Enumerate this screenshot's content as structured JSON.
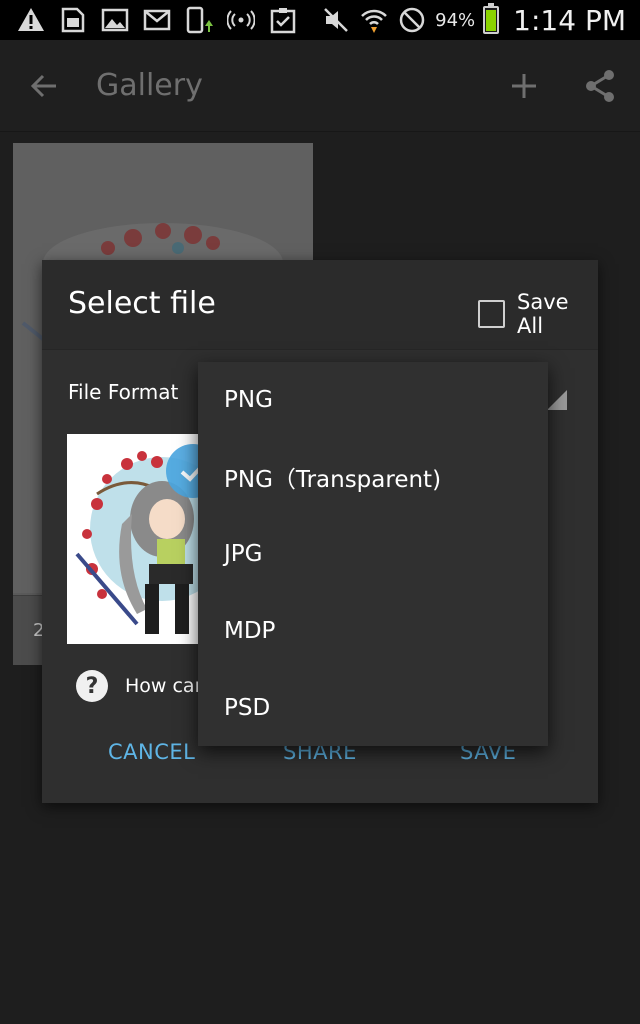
{
  "status_bar": {
    "battery_percent": "94%",
    "battery_level": 0.94,
    "time": "1:14 PM",
    "left_icons": [
      "warning-icon",
      "sim-card-icon",
      "image-icon",
      "gmail-icon",
      "phone-sync-icon",
      "radio-waves-icon",
      "clipboard-check-icon"
    ],
    "right_icons": [
      "mute-icon",
      "wifi-icon",
      "do-not-disturb-icon"
    ]
  },
  "action_bar": {
    "title": "Gallery"
  },
  "gallery": {
    "caption": "2"
  },
  "dialog": {
    "title": "Select file",
    "save_all_label": "Save All",
    "file_format_label": "File Format",
    "help_text": "How car",
    "buttons": {
      "cancel": "CANCEL",
      "share": "SHARE",
      "save": "SAVE"
    }
  },
  "dropdown": {
    "options": [
      "PNG",
      "PNG（Transparent)",
      "JPG",
      "MDP",
      "PSD"
    ]
  },
  "colors": {
    "accent": "#5fb5e6",
    "battery_green": "#8bd400",
    "dialog_bg": "#2f2f2f",
    "dropdown_bg": "#303030"
  }
}
